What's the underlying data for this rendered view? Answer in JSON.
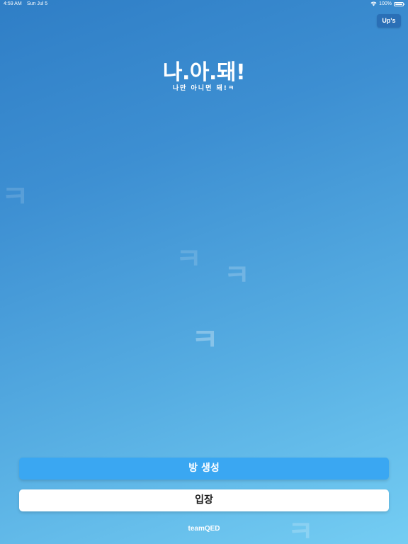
{
  "status_bar": {
    "time": "4:59 AM",
    "date": "Sun Jul 5",
    "battery": "100%"
  },
  "header": {
    "ups_label": "Up's"
  },
  "logo": {
    "title": "나.아.돼!",
    "subtitle": "나만 아니면 돼!ㅋ"
  },
  "background": {
    "glyph": "ㅋ"
  },
  "actions": {
    "create_room_label": "방 생성",
    "enter_label": "입장"
  },
  "footer": {
    "brand": "teamQED"
  },
  "colors": {
    "gradient_start": "#2f7ec6",
    "gradient_end": "#74cdf3",
    "create_button": "#3aa7f2",
    "enter_button": "#ffffff",
    "ups_button": "#2a6fb6"
  }
}
